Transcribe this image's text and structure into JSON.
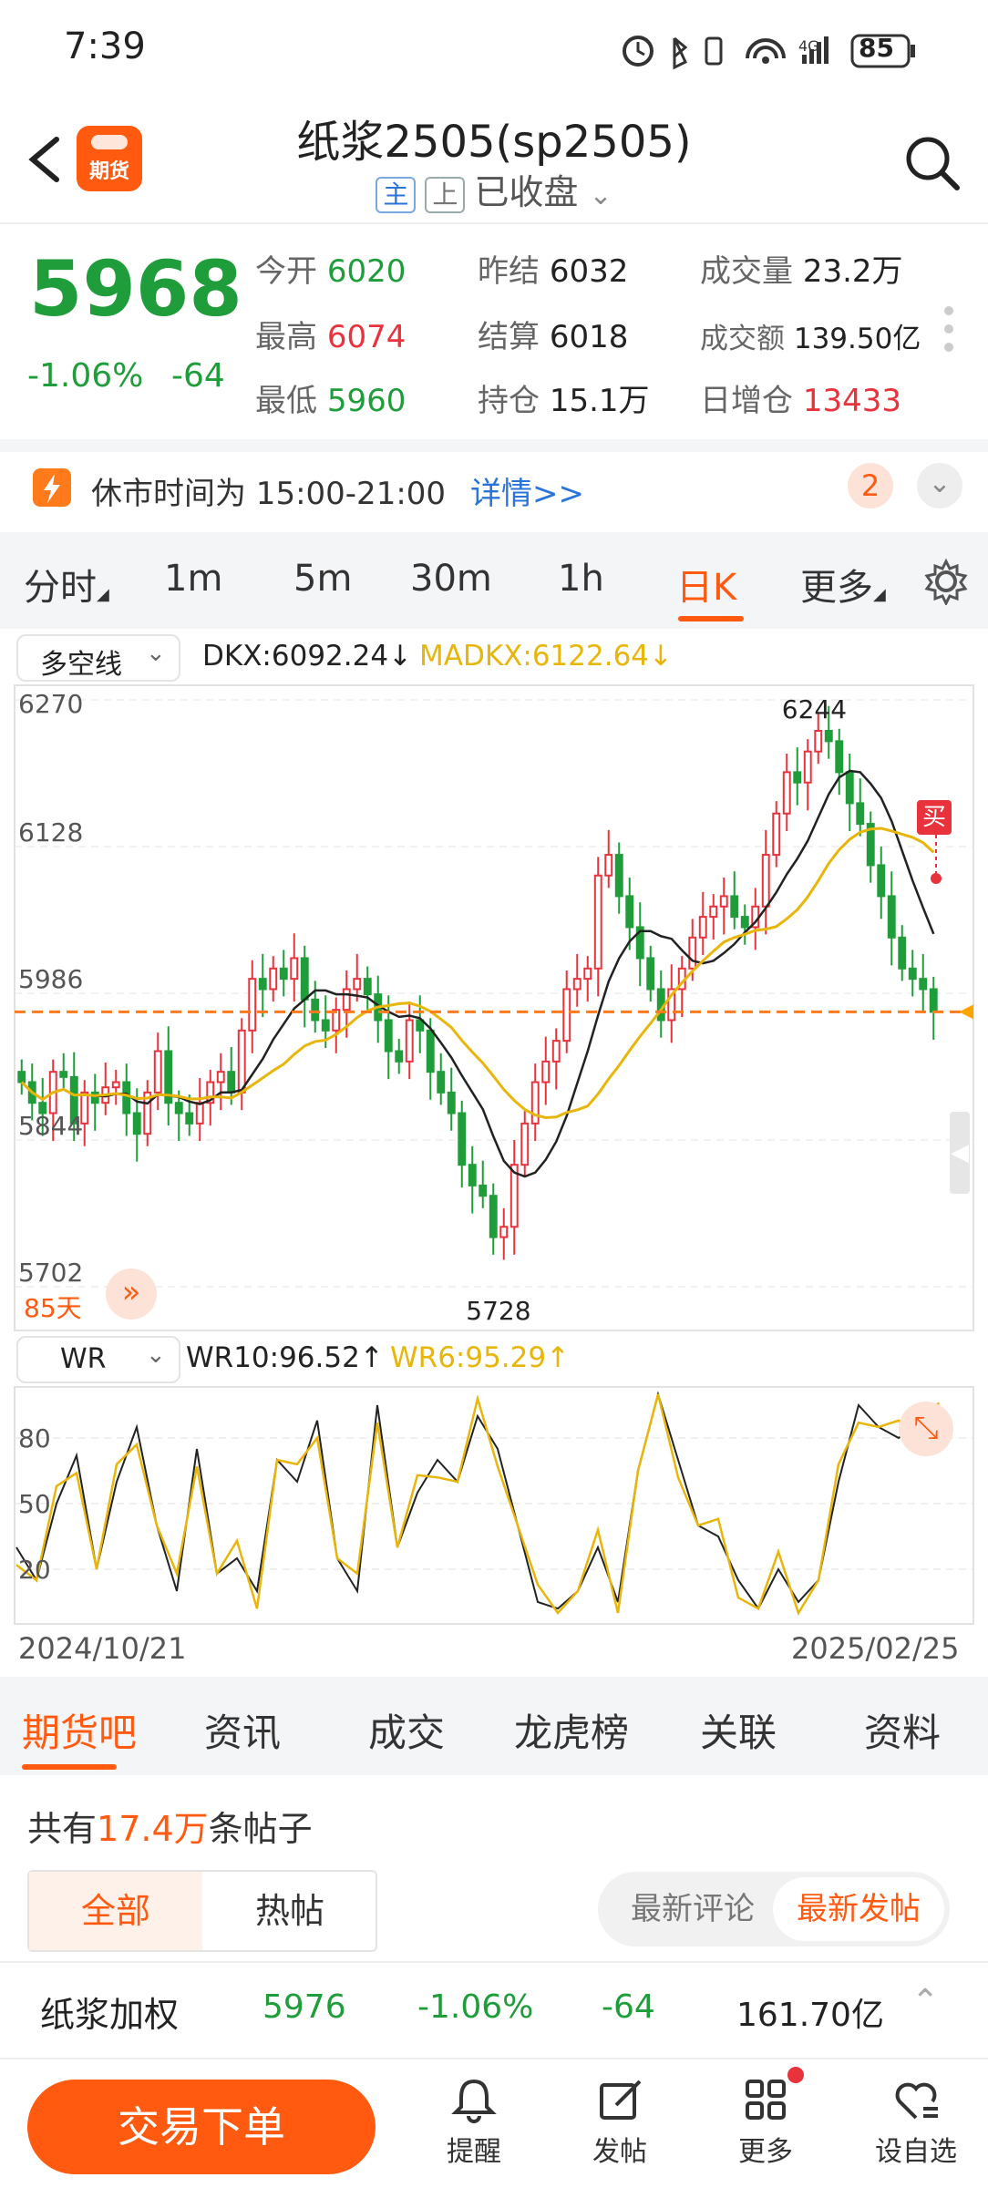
{
  "status_bar": {
    "time": "7:39",
    "battery": "85"
  },
  "header": {
    "title": "纸浆2505(sp2505)",
    "badge_main": "主",
    "badge_exchange": "上",
    "status": "已收盘",
    "app_icon_label": "期货"
  },
  "quote": {
    "price": "5968",
    "change_pct": "-1.06%",
    "change": "-64",
    "rows": [
      [
        {
          "label": "今开",
          "value": "6020"
        },
        {
          "label": "昨结",
          "value": "6032"
        },
        {
          "label": "成交量",
          "value": "23.2万"
        }
      ],
      [
        {
          "label": "最高",
          "value": "6074"
        },
        {
          "label": "结算",
          "value": "6018"
        },
        {
          "label": "成交额",
          "value": "139.50亿"
        }
      ],
      [
        {
          "label": "最低",
          "value": "5960"
        },
        {
          "label": "持仓",
          "value": "15.1万"
        },
        {
          "label": "日增仓",
          "value": "13433"
        }
      ]
    ]
  },
  "notice": {
    "text": "休市时间为 15:00-21:00",
    "link": "详情>>",
    "count": "2"
  },
  "periods": [
    "分时",
    "1m",
    "5m",
    "30m",
    "1h",
    "日K",
    "更多"
  ],
  "active_period": "日K",
  "indicator": {
    "name": "多空线",
    "dkx_label": "DKX:6092.24↓",
    "madkx_label": "MADKX:6122.64↓"
  },
  "chart_data": {
    "type": "candlestick",
    "y_ticks": [
      "6270",
      "6128",
      "5986",
      "5844",
      "5702"
    ],
    "ylim": [
      5702,
      6270
    ],
    "high_label": "6244",
    "low_label": "5728",
    "days_label": "85天",
    "buy_label": "买",
    "close_ref": 5968
  },
  "wr": {
    "name": "WR",
    "wr10_label": "WR10:96.52↑",
    "wr6_label": "WR6:95.29↑",
    "y_ticks": [
      "80",
      "50",
      "20"
    ],
    "start_date": "2024/10/21",
    "end_date": "2025/02/25"
  },
  "section_tabs": [
    "期货吧",
    "资讯",
    "成交",
    "龙虎榜",
    "关联",
    "资料"
  ],
  "active_section": "期货吧",
  "posts": {
    "prefix": "共有",
    "count": "17.4万",
    "suffix": "条帖子",
    "filter_all": "全部",
    "filter_hot": "热帖",
    "sort_comment": "最新评论",
    "sort_post": "最新发帖"
  },
  "related": {
    "name": "纸浆加权",
    "price": "5976",
    "pct": "-1.06%",
    "change": "-64",
    "amount": "161.70亿"
  },
  "bottom_bar": {
    "trade_button": "交易下单",
    "actions": [
      "提醒",
      "发帖",
      "更多",
      "设自选"
    ]
  },
  "colors": {
    "accent": "#ff5a10",
    "up": "#e8323c",
    "down": "#1f9d3a",
    "dkx": "#222222",
    "madkx": "#e8b60b"
  }
}
